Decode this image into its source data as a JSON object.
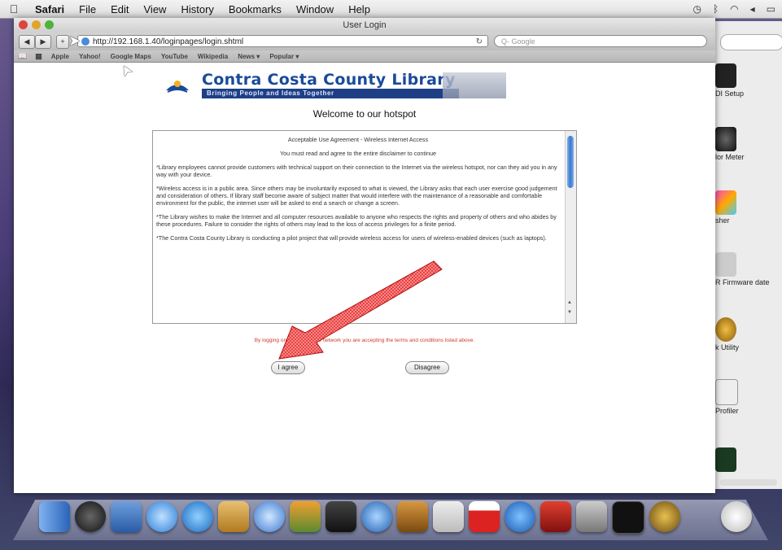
{
  "menubar": {
    "items": [
      "Safari",
      "File",
      "Edit",
      "View",
      "History",
      "Bookmarks",
      "Window",
      "Help"
    ]
  },
  "window": {
    "title": "User Login"
  },
  "toolbar": {
    "back": "◀",
    "forward": "▶",
    "url": "http://192.168.1.40/loginpages/login.shtml",
    "search_placeholder": "Q- Google"
  },
  "bookmarks": [
    "Apple",
    "Yahoo!",
    "Google Maps",
    "YouTube",
    "Wikipedia",
    "News ▾",
    "Popular ▾"
  ],
  "page": {
    "library_name": "Contra Costa County Library",
    "tagline": "Bringing People and Ideas Together",
    "welcome": "Welcome to our hotspot",
    "agreement": {
      "heading": "Acceptable Use Agreement - Wireless Internet Access",
      "subheading": "You must read and agree to the entire disclaimer to continue",
      "p1": "*Library employees cannot provide customers with technical support on their connection to the Internet via the wireless hotspot, nor can they aid you in any way with your device.",
      "p2": "*Wireless access is in a public area. Since others may be involuntarily exposed to what is viewed, the Library asks that each user exercise good judgement and consideration of others. If library staff become aware of subject matter that would interfere with the maintenance of a reasonable and comfortable environment for the public, the internet user will be asked to end a search or change a screen.",
      "p3": "*The Library wishes to make the Internet and all computer resources available to anyone who respects the rights and property of others and who abides by these procedures. Failure to consider the rights of others may lead to the loss of access privileges for a finite period.",
      "p4": "*The Contra Costa County Library is conducting a pilot project that will provide wireless access for users of wireless-enabled devices (such as laptops)."
    },
    "notice": "By logging onto this wireless network you are accepting the terms and conditions listed above.",
    "agree_label": "I agree",
    "disagree_label": "Disagree"
  },
  "utilities": [
    "DI Setup",
    "lor Meter",
    "sher",
    "R Firmware date",
    "k Utility",
    "Profiler"
  ],
  "colors": {
    "accent": "#1a4a9a",
    "notice": "#d03a2a",
    "arrow": "#e02020"
  }
}
